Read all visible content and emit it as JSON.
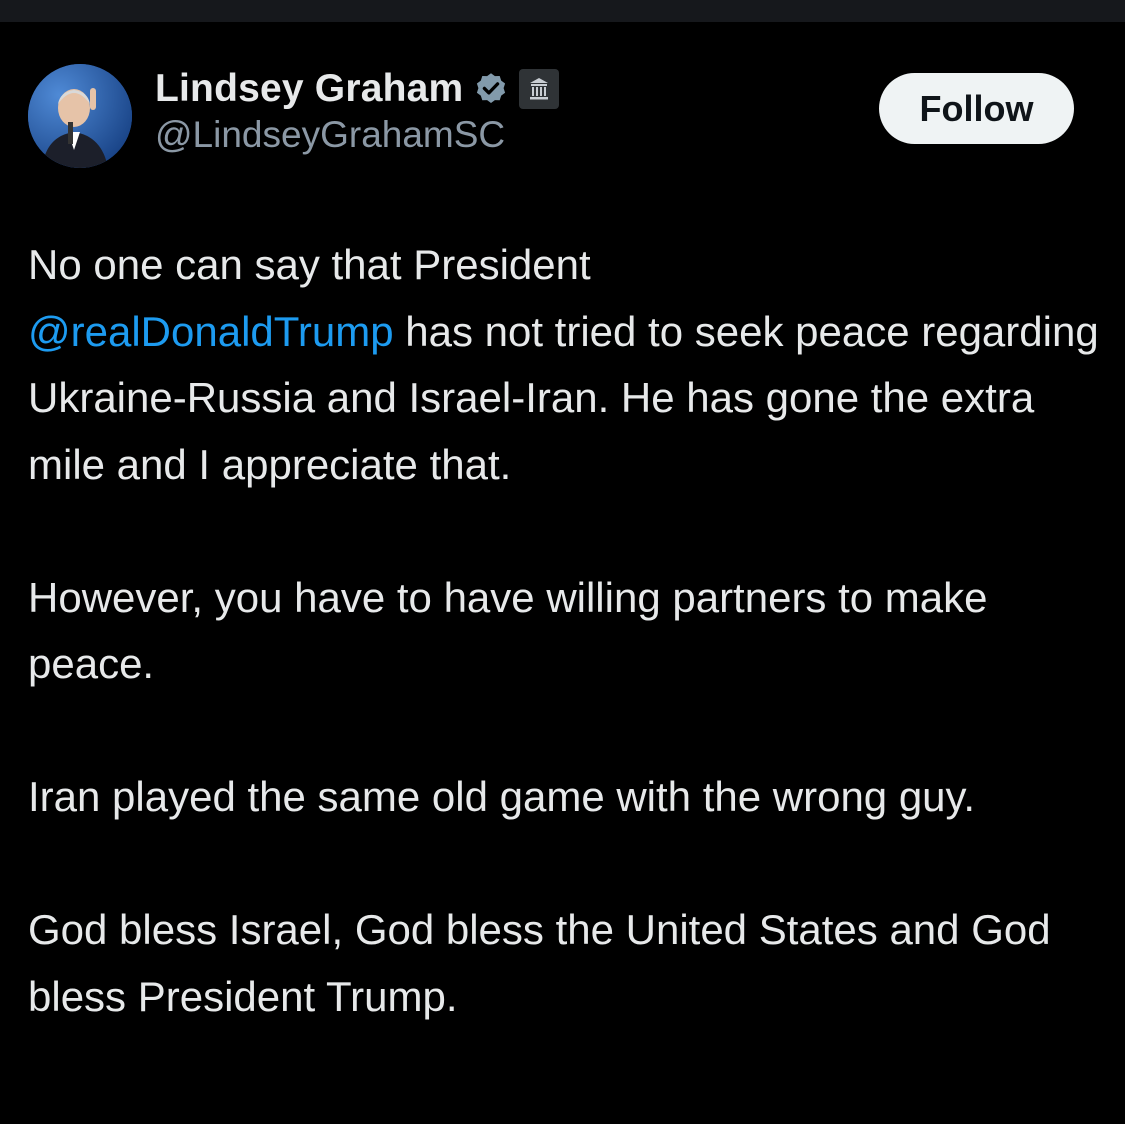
{
  "author": {
    "display_name": "Lindsey Graham",
    "handle": "@LindseyGrahamSC",
    "verified_badge_icon": "verified-badge-icon",
    "affiliation_badge_icon": "government-building-icon"
  },
  "header": {
    "follow_label": "Follow"
  },
  "tweet": {
    "p1_line1": "No one can say that President",
    "p1_mention": "@realDonaldTrump",
    "p1_rest": " has not tried to seek peace regarding Ukraine-Russia and Israel-Iran. He has gone the extra mile and I appreciate that.",
    "p2": "However, you have to have willing partners to make peace.",
    "p3": "Iran played the same old game with the wrong guy.",
    "p4": "God bless Israel, God bless the United States and God bless President Trump."
  },
  "colors": {
    "background": "#000000",
    "text": "#e7e9ea",
    "secondary_text": "#8b98a5",
    "link": "#1d9bf0",
    "verified": "#829aab",
    "button_bg": "#eff3f4",
    "button_text": "#0f1419"
  }
}
